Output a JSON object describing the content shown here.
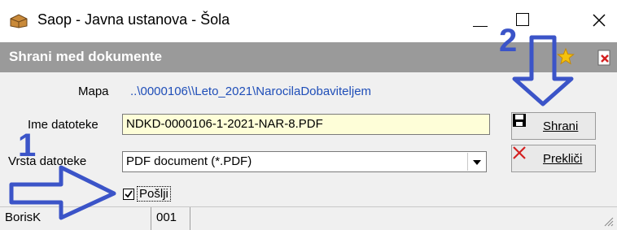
{
  "window": {
    "title": "Saop  - Javna ustanova - Šola",
    "minimize_icon": "minimize-icon",
    "maximize_icon": "maximize-icon",
    "close_icon": "close-icon"
  },
  "header": {
    "title": "Shrani med dokumente",
    "star_icon": "star-icon",
    "delete_icon": "delete-icon"
  },
  "form": {
    "folder_label": "Mapa",
    "folder_path": "..\\0000106\\\\Leto_2021\\NarocilaDobaviteljem",
    "filename_label": "Ime datoteke",
    "filename_value": "NDKD-0000106-1-2021-NAR-8.PDF",
    "filetype_label": "Vrsta datoteke",
    "filetype_value": "PDF document (*.PDF)",
    "send_label": "Pošlji",
    "send_checked": true
  },
  "buttons": {
    "save_label": "Shrani",
    "cancel_label": "Prekliči"
  },
  "status": {
    "user": "BorisK",
    "code": "001"
  },
  "annotations": {
    "step1": "1",
    "step2": "2",
    "color": "#3b54c8"
  }
}
